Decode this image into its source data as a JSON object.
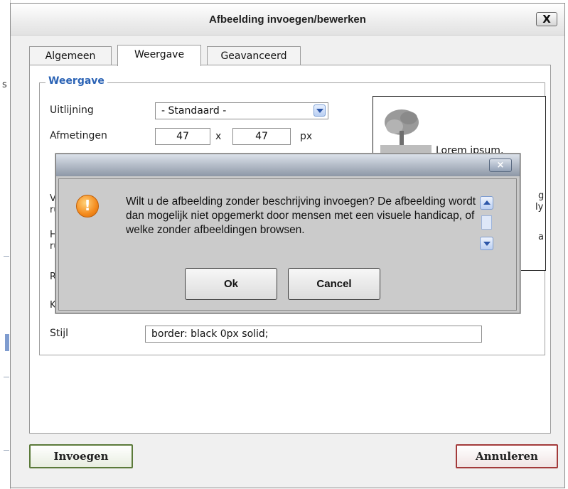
{
  "dialog": {
    "title": "Afbeelding invoegen/bewerken",
    "close_label": "X"
  },
  "tabs": [
    {
      "label": "Algemeen",
      "active": false
    },
    {
      "label": "Weergave",
      "active": true
    },
    {
      "label": "Geavanceerd",
      "active": false
    }
  ],
  "weergave": {
    "legend": "Weergave",
    "alignment_label": "Uitlijning",
    "alignment_value": "- Standaard -",
    "dimensions_label": "Afmetingen",
    "width_value": "47",
    "dim_separator": "x",
    "height_value": "47",
    "unit": "px",
    "style_label": "Stijl",
    "style_value": "border: black 0px solid;",
    "preview_text": "Lorem ipsum,",
    "hidden_fragments": [
      "V",
      "ru",
      "H",
      "ru",
      "R",
      "K",
      "g",
      "ly",
      "a"
    ]
  },
  "footer": {
    "insert_label": "Invoegen",
    "cancel_label": "Annuleren"
  },
  "modal": {
    "close_label": "×",
    "warning_glyph": "!",
    "message": "Wilt u de afbeelding zonder beschrijving invoegen? De afbeelding wordt dan mogelijk niet opgemerkt door mensen met een visuele handicap, of welke zonder afbeeldingen browsen.",
    "ok_label": "Ok",
    "cancel_label": "Cancel"
  },
  "background_page": {
    "side_char": "s"
  },
  "colors": {
    "legend": "#2b63b5",
    "insert_border": "#5b7a3a",
    "cancel_border": "#a33a3a",
    "warning": "#f48a1c"
  }
}
